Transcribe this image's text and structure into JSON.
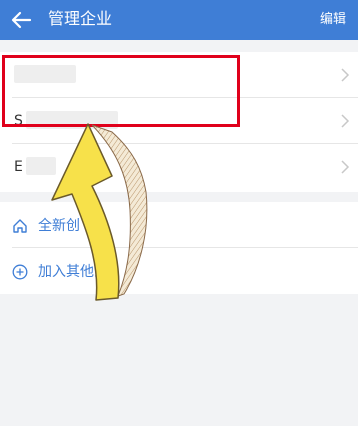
{
  "header": {
    "title": "管理企业",
    "edit_label": "编辑",
    "background": "#3f7ed6"
  },
  "companies": [
    {
      "label": "",
      "obscured": true
    },
    {
      "label": "S",
      "obscured": true
    },
    {
      "label": "E",
      "obscured": true
    }
  ],
  "actions": [
    {
      "label": "全新创",
      "icon": "home-icon"
    },
    {
      "label": "加入其他企",
      "icon": "plus-circle-icon"
    }
  ],
  "annotation": {
    "highlight_color": "#e0001b",
    "arrow_color": "#f7e14a"
  }
}
